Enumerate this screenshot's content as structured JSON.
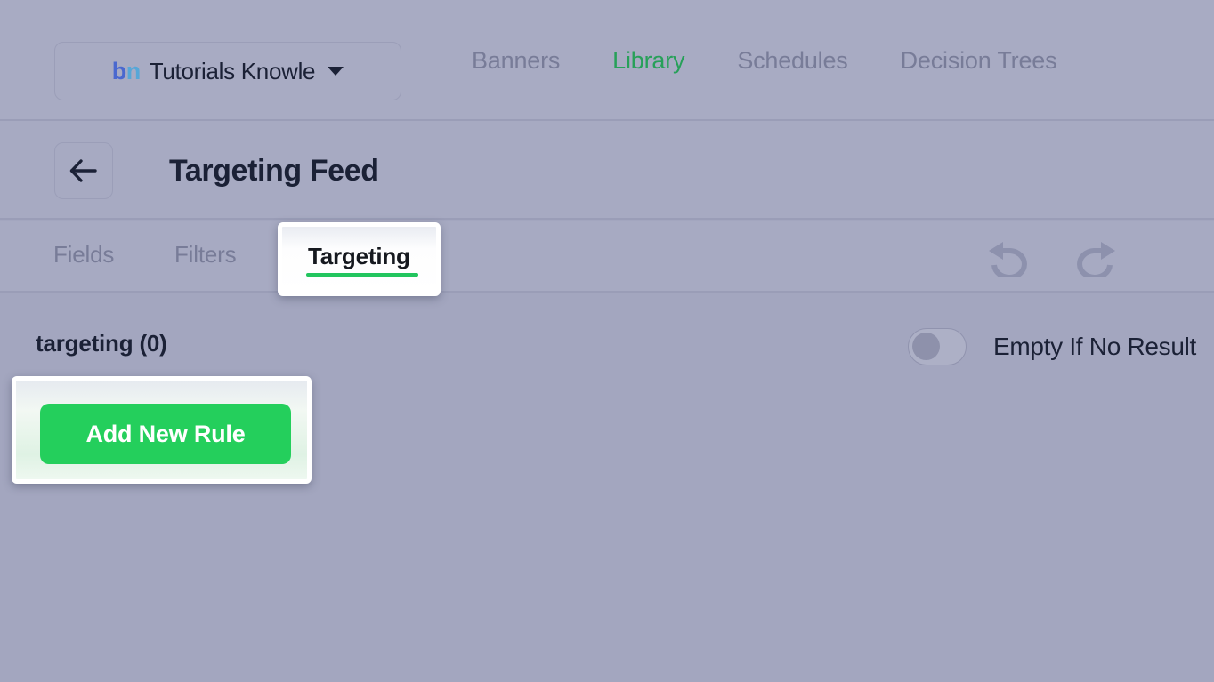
{
  "topbar": {
    "workspace": {
      "logo_b": "b",
      "logo_n": "n",
      "name": "Tutorials Knowle",
      "caret_icon": "chevron-down-icon"
    },
    "nav": [
      {
        "label": "Banners",
        "active": false
      },
      {
        "label": "Library",
        "active": true
      },
      {
        "label": "Schedules",
        "active": false
      },
      {
        "label": "Decision Trees",
        "active": false
      }
    ]
  },
  "pageheader": {
    "back_icon": "arrow-left-icon",
    "title": "Targeting Feed"
  },
  "tabs": {
    "items": [
      {
        "label": "Fields",
        "active": false
      },
      {
        "label": "Filters",
        "active": false
      },
      {
        "label": "Targeting",
        "active": true
      }
    ],
    "fields_label": "Fields",
    "filters_label": "Filters",
    "targeting_label": "Targeting",
    "history": {
      "undo_icon": "undo-icon",
      "redo_icon": "redo-icon"
    }
  },
  "content": {
    "section_title": "targeting (0)",
    "empty_if_no_result": {
      "label": "Empty If No Result",
      "enabled": false
    },
    "add_rule_label": "Add New Rule"
  },
  "colors": {
    "background": "#a3a6bf",
    "panel": "#a7aac2",
    "accent_green": "#22c55e",
    "button_green": "#24cf5c",
    "nav_active_green": "#27a059",
    "text_dark": "#1b2136",
    "text_muted": "#787c98",
    "logo_b": "#4a68cf",
    "logo_n": "#57a7d8"
  }
}
